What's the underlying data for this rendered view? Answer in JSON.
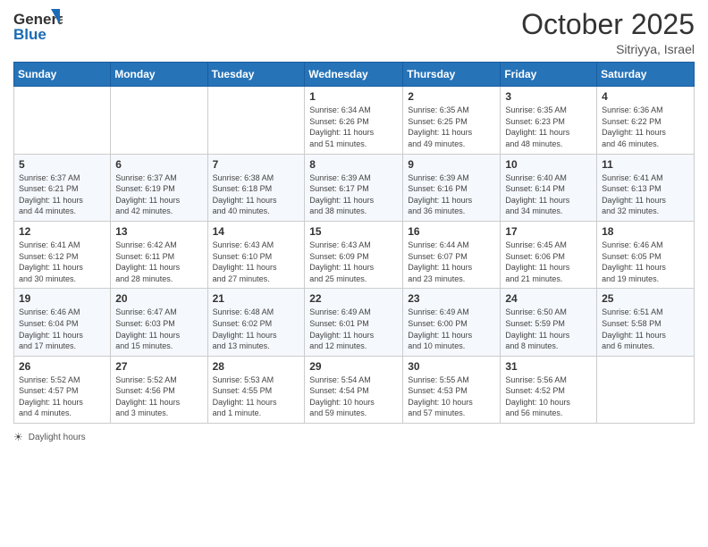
{
  "header": {
    "logo_line1": "General",
    "logo_line2": "Blue",
    "month": "October 2025",
    "location": "Sitriyya, Israel"
  },
  "weekdays": [
    "Sunday",
    "Monday",
    "Tuesday",
    "Wednesday",
    "Thursday",
    "Friday",
    "Saturday"
  ],
  "weeks": [
    [
      {
        "day": "",
        "info": ""
      },
      {
        "day": "",
        "info": ""
      },
      {
        "day": "",
        "info": ""
      },
      {
        "day": "1",
        "info": "Sunrise: 6:34 AM\nSunset: 6:26 PM\nDaylight: 11 hours\nand 51 minutes."
      },
      {
        "day": "2",
        "info": "Sunrise: 6:35 AM\nSunset: 6:25 PM\nDaylight: 11 hours\nand 49 minutes."
      },
      {
        "day": "3",
        "info": "Sunrise: 6:35 AM\nSunset: 6:23 PM\nDaylight: 11 hours\nand 48 minutes."
      },
      {
        "day": "4",
        "info": "Sunrise: 6:36 AM\nSunset: 6:22 PM\nDaylight: 11 hours\nand 46 minutes."
      }
    ],
    [
      {
        "day": "5",
        "info": "Sunrise: 6:37 AM\nSunset: 6:21 PM\nDaylight: 11 hours\nand 44 minutes."
      },
      {
        "day": "6",
        "info": "Sunrise: 6:37 AM\nSunset: 6:19 PM\nDaylight: 11 hours\nand 42 minutes."
      },
      {
        "day": "7",
        "info": "Sunrise: 6:38 AM\nSunset: 6:18 PM\nDaylight: 11 hours\nand 40 minutes."
      },
      {
        "day": "8",
        "info": "Sunrise: 6:39 AM\nSunset: 6:17 PM\nDaylight: 11 hours\nand 38 minutes."
      },
      {
        "day": "9",
        "info": "Sunrise: 6:39 AM\nSunset: 6:16 PM\nDaylight: 11 hours\nand 36 minutes."
      },
      {
        "day": "10",
        "info": "Sunrise: 6:40 AM\nSunset: 6:14 PM\nDaylight: 11 hours\nand 34 minutes."
      },
      {
        "day": "11",
        "info": "Sunrise: 6:41 AM\nSunset: 6:13 PM\nDaylight: 11 hours\nand 32 minutes."
      }
    ],
    [
      {
        "day": "12",
        "info": "Sunrise: 6:41 AM\nSunset: 6:12 PM\nDaylight: 11 hours\nand 30 minutes."
      },
      {
        "day": "13",
        "info": "Sunrise: 6:42 AM\nSunset: 6:11 PM\nDaylight: 11 hours\nand 28 minutes."
      },
      {
        "day": "14",
        "info": "Sunrise: 6:43 AM\nSunset: 6:10 PM\nDaylight: 11 hours\nand 27 minutes."
      },
      {
        "day": "15",
        "info": "Sunrise: 6:43 AM\nSunset: 6:09 PM\nDaylight: 11 hours\nand 25 minutes."
      },
      {
        "day": "16",
        "info": "Sunrise: 6:44 AM\nSunset: 6:07 PM\nDaylight: 11 hours\nand 23 minutes."
      },
      {
        "day": "17",
        "info": "Sunrise: 6:45 AM\nSunset: 6:06 PM\nDaylight: 11 hours\nand 21 minutes."
      },
      {
        "day": "18",
        "info": "Sunrise: 6:46 AM\nSunset: 6:05 PM\nDaylight: 11 hours\nand 19 minutes."
      }
    ],
    [
      {
        "day": "19",
        "info": "Sunrise: 6:46 AM\nSunset: 6:04 PM\nDaylight: 11 hours\nand 17 minutes."
      },
      {
        "day": "20",
        "info": "Sunrise: 6:47 AM\nSunset: 6:03 PM\nDaylight: 11 hours\nand 15 minutes."
      },
      {
        "day": "21",
        "info": "Sunrise: 6:48 AM\nSunset: 6:02 PM\nDaylight: 11 hours\nand 13 minutes."
      },
      {
        "day": "22",
        "info": "Sunrise: 6:49 AM\nSunset: 6:01 PM\nDaylight: 11 hours\nand 12 minutes."
      },
      {
        "day": "23",
        "info": "Sunrise: 6:49 AM\nSunset: 6:00 PM\nDaylight: 11 hours\nand 10 minutes."
      },
      {
        "day": "24",
        "info": "Sunrise: 6:50 AM\nSunset: 5:59 PM\nDaylight: 11 hours\nand 8 minutes."
      },
      {
        "day": "25",
        "info": "Sunrise: 6:51 AM\nSunset: 5:58 PM\nDaylight: 11 hours\nand 6 minutes."
      }
    ],
    [
      {
        "day": "26",
        "info": "Sunrise: 5:52 AM\nSunset: 4:57 PM\nDaylight: 11 hours\nand 4 minutes."
      },
      {
        "day": "27",
        "info": "Sunrise: 5:52 AM\nSunset: 4:56 PM\nDaylight: 11 hours\nand 3 minutes."
      },
      {
        "day": "28",
        "info": "Sunrise: 5:53 AM\nSunset: 4:55 PM\nDaylight: 11 hours\nand 1 minute."
      },
      {
        "day": "29",
        "info": "Sunrise: 5:54 AM\nSunset: 4:54 PM\nDaylight: 10 hours\nand 59 minutes."
      },
      {
        "day": "30",
        "info": "Sunrise: 5:55 AM\nSunset: 4:53 PM\nDaylight: 10 hours\nand 57 minutes."
      },
      {
        "day": "31",
        "info": "Sunrise: 5:56 AM\nSunset: 4:52 PM\nDaylight: 10 hours\nand 56 minutes."
      },
      {
        "day": "",
        "info": ""
      }
    ]
  ],
  "footer": {
    "daylight_label": "Daylight hours"
  }
}
